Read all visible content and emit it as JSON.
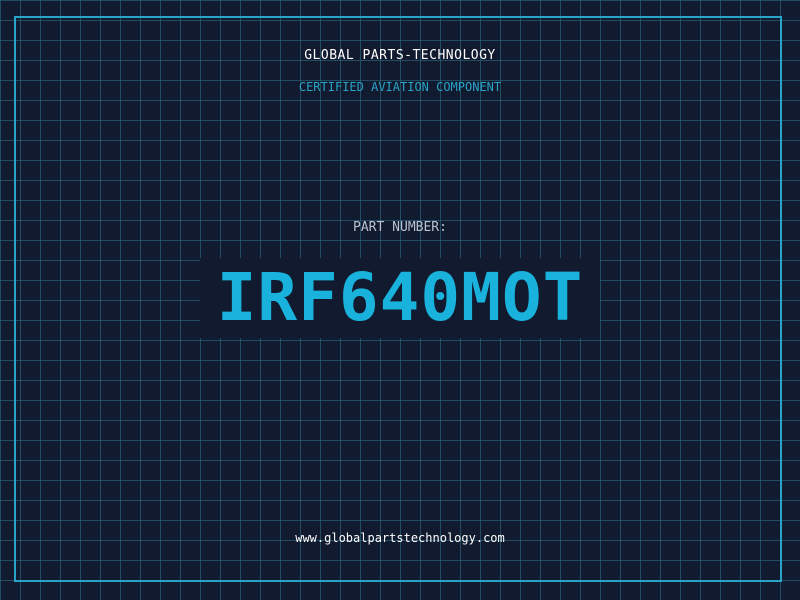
{
  "header": {
    "company": "GLOBAL PARTS-TECHNOLOGY",
    "subtitle": "CERTIFIED AVIATION COMPONENT"
  },
  "part": {
    "label": "PART NUMBER:",
    "number": "IRF640MOT"
  },
  "footer": {
    "website": "www.globalpartstechnology.com"
  },
  "colors": {
    "background": "#111a2e",
    "grid": "#2c768c",
    "accent": "#2aa3c8",
    "part_number": "#18b2dc",
    "text": "#ffffff",
    "label": "#b8c2d0"
  }
}
